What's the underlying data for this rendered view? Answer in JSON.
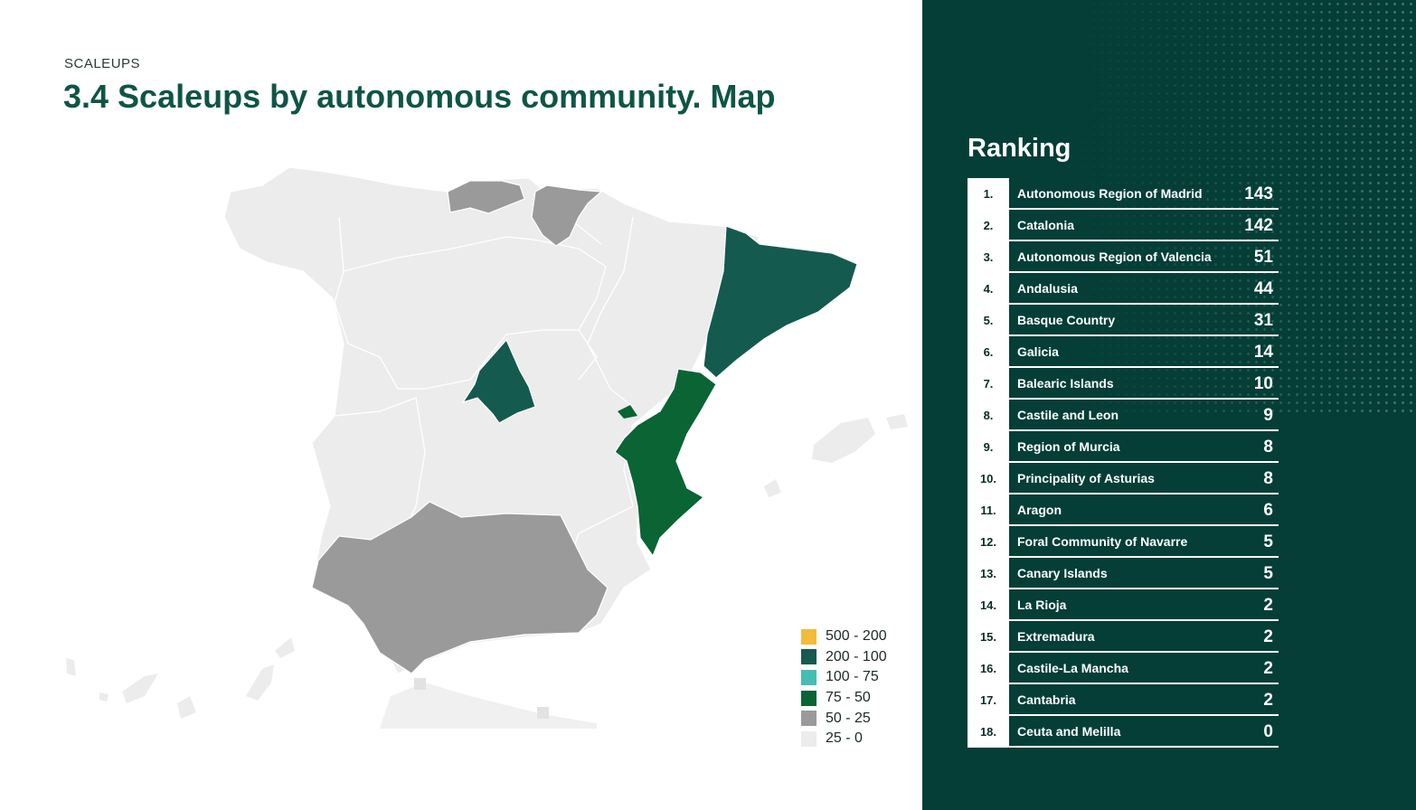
{
  "header": {
    "eyebrow": "SCALEUPS",
    "title": "3.4 Scaleups by autonomous community. Map"
  },
  "colors": {
    "range_500_200": "#f2bb3a",
    "range_200_100": "#155a4e",
    "range_100_75": "#44bdb4",
    "range_75_50": "#0b6434",
    "range_50_25": "#9a9a9a",
    "range_25_0": "#ececec",
    "panel_background": "#043e37"
  },
  "legend": [
    {
      "label": "500 - 200",
      "color": "#f2bb3a"
    },
    {
      "label": "200 - 100",
      "color": "#155a4e"
    },
    {
      "label": "100 - 75",
      "color": "#44bdb4"
    },
    {
      "label": "75 - 50",
      "color": "#0b6434"
    },
    {
      "label": "50 - 25",
      "color": "#9a9a9a"
    },
    {
      "label": "25 - 0",
      "color": "#ececec"
    }
  ],
  "ranking": {
    "title": "Ranking",
    "rows": [
      {
        "rank": "1.",
        "name": "Autonomous Region of Madrid",
        "value": "143"
      },
      {
        "rank": "2.",
        "name": "Catalonia",
        "value": "142"
      },
      {
        "rank": "3.",
        "name": "Autonomous Region of Valencia",
        "value": "51"
      },
      {
        "rank": "4.",
        "name": "Andalusia",
        "value": "44"
      },
      {
        "rank": "5.",
        "name": "Basque Country",
        "value": "31"
      },
      {
        "rank": "6.",
        "name": "Galicia",
        "value": "14"
      },
      {
        "rank": "7.",
        "name": "Balearic Islands",
        "value": "10"
      },
      {
        "rank": "8.",
        "name": "Castile and Leon",
        "value": "9"
      },
      {
        "rank": "9.",
        "name": "Region of Murcia",
        "value": "8"
      },
      {
        "rank": "10.",
        "name": "Principality of Asturias",
        "value": "8"
      },
      {
        "rank": "11.",
        "name": "Aragon",
        "value": "6"
      },
      {
        "rank": "12.",
        "name": "Foral Community of Navarre",
        "value": "5"
      },
      {
        "rank": "13.",
        "name": "Canary Islands",
        "value": "5"
      },
      {
        "rank": "14.",
        "name": "La Rioja",
        "value": "2"
      },
      {
        "rank": "15.",
        "name": "Extremadura",
        "value": "2"
      },
      {
        "rank": "16.",
        "name": "Castile-La Mancha",
        "value": "2"
      },
      {
        "rank": "17.",
        "name": "Cantabria",
        "value": "2"
      },
      {
        "rank": "18.",
        "name": "Ceuta and Melilla",
        "value": "0"
      }
    ]
  }
}
